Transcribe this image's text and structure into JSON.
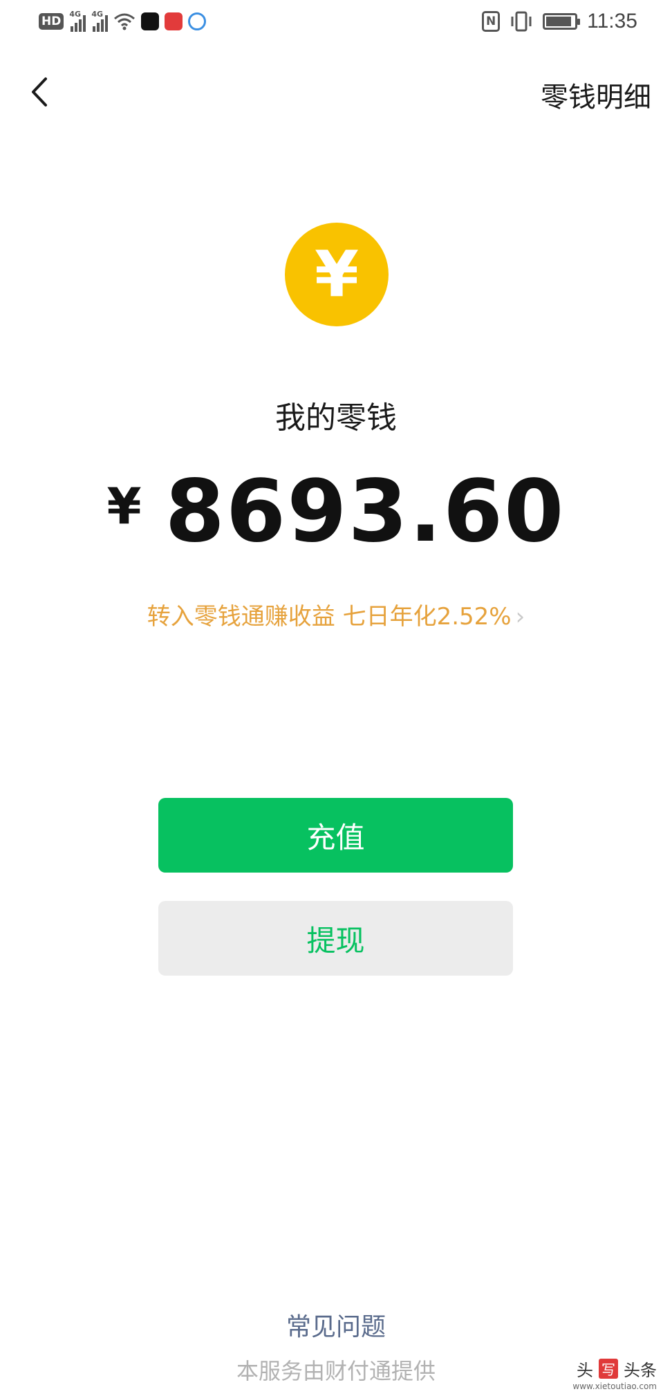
{
  "status_bar": {
    "hd": "HD",
    "network1": "4G",
    "network2": "4G",
    "nfc": "N",
    "time": "11:35",
    "battery_level": 0.9
  },
  "nav": {
    "detail_link": "零钱明细"
  },
  "coin": {
    "symbol": "¥",
    "color": "#f9c200"
  },
  "wallet": {
    "title": "我的零钱",
    "currency": "¥",
    "balance": "8693.60",
    "promo": "转入零钱通赚收益 七日年化2.52%",
    "promo_chevron": "›"
  },
  "actions": {
    "recharge": "充值",
    "withdraw": "提现"
  },
  "footer": {
    "faq": "常见问题",
    "provider": "本服务由财付通提供"
  },
  "watermark": {
    "prefix": "头",
    "badge": "写",
    "name": "头条",
    "site": "www.xietoutiao.com"
  },
  "colors": {
    "accent_green": "#07c160",
    "promo_orange": "#e6a23c",
    "link_blue": "#5a6b8c"
  }
}
